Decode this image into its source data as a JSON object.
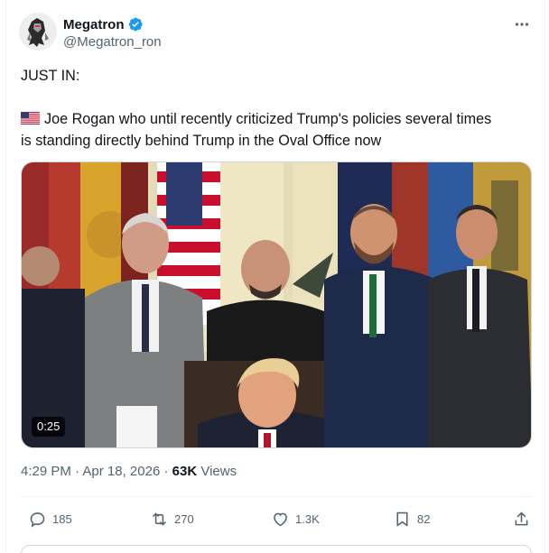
{
  "author": {
    "display_name": "Megatron",
    "handle": "@Megatron_ron",
    "verified": true
  },
  "tweet": {
    "line1": "JUST IN:",
    "line2": "Joe Rogan  who until recently criticized Trump's policies several times",
    "line3": "is standing directly behind Trump in the Oval Office now",
    "flag_icon": "us-flag-emoji"
  },
  "media": {
    "duration": "0:25"
  },
  "meta": {
    "time": "4:29 PM",
    "separator": " · ",
    "date": "Apr 18, 2026",
    "separator2": " · ",
    "views_count": "63K",
    "views_label": " Views"
  },
  "actions": {
    "replies": "185",
    "reposts": "270",
    "likes": "1.3K",
    "bookmarks": "82"
  },
  "colors": {
    "text": "#0f1419",
    "secondary": "#536471",
    "verified": "#1d9bf0",
    "border": "#eff3f4"
  }
}
